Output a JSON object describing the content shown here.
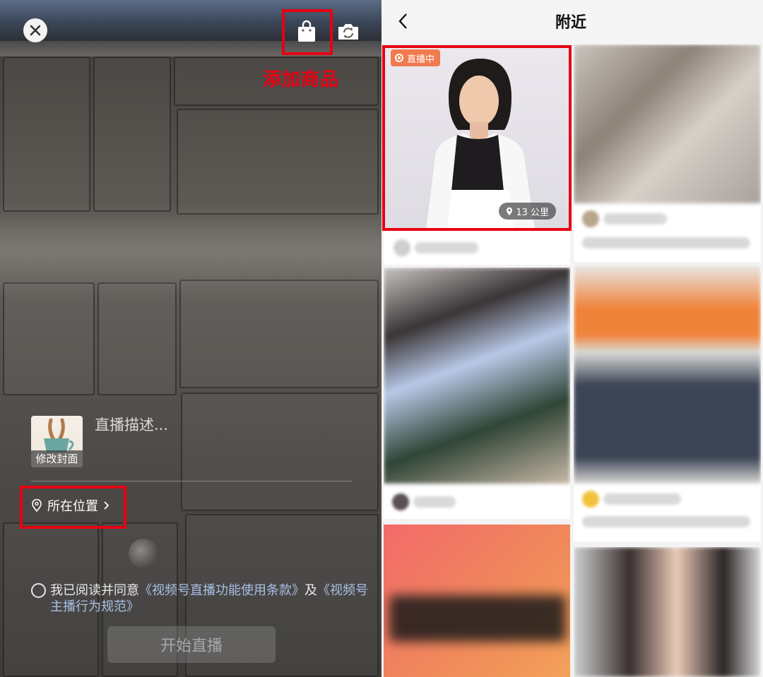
{
  "left": {
    "annotation": "添加商品",
    "cover_label": "修改封面",
    "description_placeholder": "直播描述...",
    "location_label": "所在位置",
    "agreement": {
      "prefix": "我已阅读并同意",
      "link1": "《视频号直播功能使用条款》",
      "middle": "及",
      "link2": "《视频号主播行为规范》"
    },
    "start_button": "开始直播",
    "icons": [
      "close-icon",
      "shopping-bag-icon",
      "switch-camera-icon",
      "location-pin-icon",
      "chevron-right-icon"
    ],
    "highlight_color": "#e60012"
  },
  "right": {
    "title": "附近",
    "first_card": {
      "live_badge": "直播中",
      "distance": "13 公里"
    },
    "accent": "#f07b4f"
  }
}
